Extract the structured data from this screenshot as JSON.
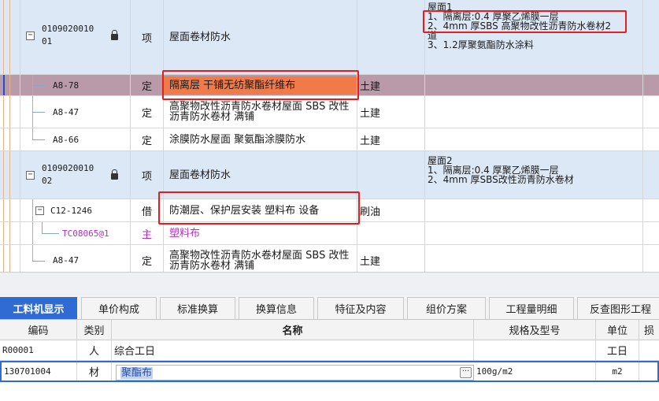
{
  "top_rows": [
    {
      "code_line1": "0109020010",
      "code_line2": "01",
      "type": "项",
      "name": "屋面卷材防水",
      "spec": "",
      "features": [
        "屋面1",
        "1、隔离层:0.4 厚聚乙烯膜一层",
        "2、4mm 厚SBS 高聚物改性沥青防水卷材2",
        "道",
        "3、1.2厚聚氨酯防水涂料"
      ]
    },
    {
      "code": "A8-78",
      "type": "定",
      "name": "隔离层 干铺无纺聚酯纤维布",
      "spec": "土建"
    },
    {
      "code": "A8-47",
      "type": "定",
      "name": "高聚物改性沥青防水卷材屋面 SBS 改性沥青防水卷材 满铺",
      "spec": "土建"
    },
    {
      "code": "A8-66",
      "type": "定",
      "name": "涂膜防水屋面 聚氨酯涂膜防水",
      "spec": "土建"
    },
    {
      "code_line1": "0109020010",
      "code_line2": "02",
      "type": "项",
      "name": "屋面卷材防水",
      "spec": "",
      "features": [
        "屋面2",
        "1、隔离层:0.4 厚聚乙烯膜一层",
        "2、4mm 厚SBS改性沥青防水卷材"
      ]
    },
    {
      "code": "C12-1246",
      "type": "借",
      "name": "防潮层、保护层安装 塑料布 设备",
      "spec": "刷油"
    },
    {
      "code": "TC08065@1",
      "type": "主",
      "name": "塑料布",
      "spec": ""
    },
    {
      "code": "A8-47",
      "type": "定",
      "name": "高聚物改性沥青防水卷材屋面 SBS 改性沥青防水卷材 满铺",
      "spec": "土建"
    }
  ],
  "tabs": [
    "工料机显示",
    "单价构成",
    "标准换算",
    "换算信息",
    "特征及内容",
    "组价方案",
    "工程量明细",
    "反查图形工程"
  ],
  "bottom": {
    "headers": {
      "code": "编码",
      "category": "类别",
      "name": "名称",
      "spec": "规格及型号",
      "unit": "单位",
      "loss": "损"
    },
    "rows": [
      {
        "code": "R00001",
        "category": "人",
        "name": "综合工日",
        "spec": "",
        "unit": "工日"
      },
      {
        "code": "130701004",
        "category": "材",
        "name": "聚酯布",
        "spec": "100g/m2",
        "unit": "m2"
      }
    ],
    "ellipsis_label": "···"
  },
  "colors": {
    "accent": "#2f6bd3",
    "highlight_box": "#e02020",
    "selected_row": "#b89aa8",
    "selected_cell": "#f07a48",
    "group_row": "#dde8f6",
    "main_material": "#b030c0"
  }
}
